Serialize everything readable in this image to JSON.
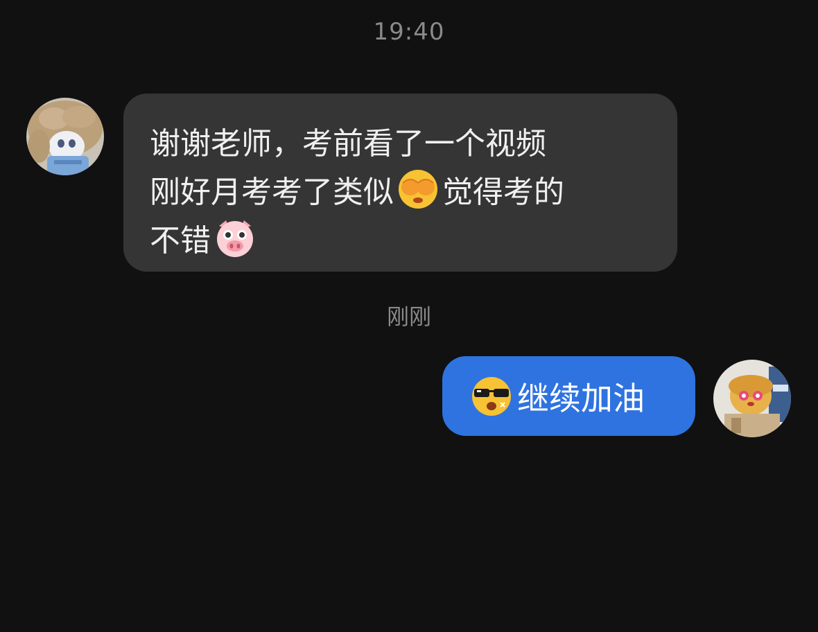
{
  "chat": {
    "time_top": "19:40",
    "time_bottom": "刚刚",
    "incoming": {
      "line1": "谢谢老师，考前看了一个视频",
      "line2_a": "刚好月考考了类似",
      "line2_emoji": "face-covering-eyes-emoji",
      "line2_b": "觉得考的",
      "line3": "不错",
      "line3_emoji": "pig-face-emoji"
    },
    "outgoing": {
      "emoji": "sunglasses-face-emoji",
      "text": "继续加油"
    }
  },
  "colors": {
    "background": "#111111",
    "incoming_bubble": "#353535",
    "outgoing_bubble": "#2f73e0",
    "timestamp_text": "#8a8a8a"
  }
}
